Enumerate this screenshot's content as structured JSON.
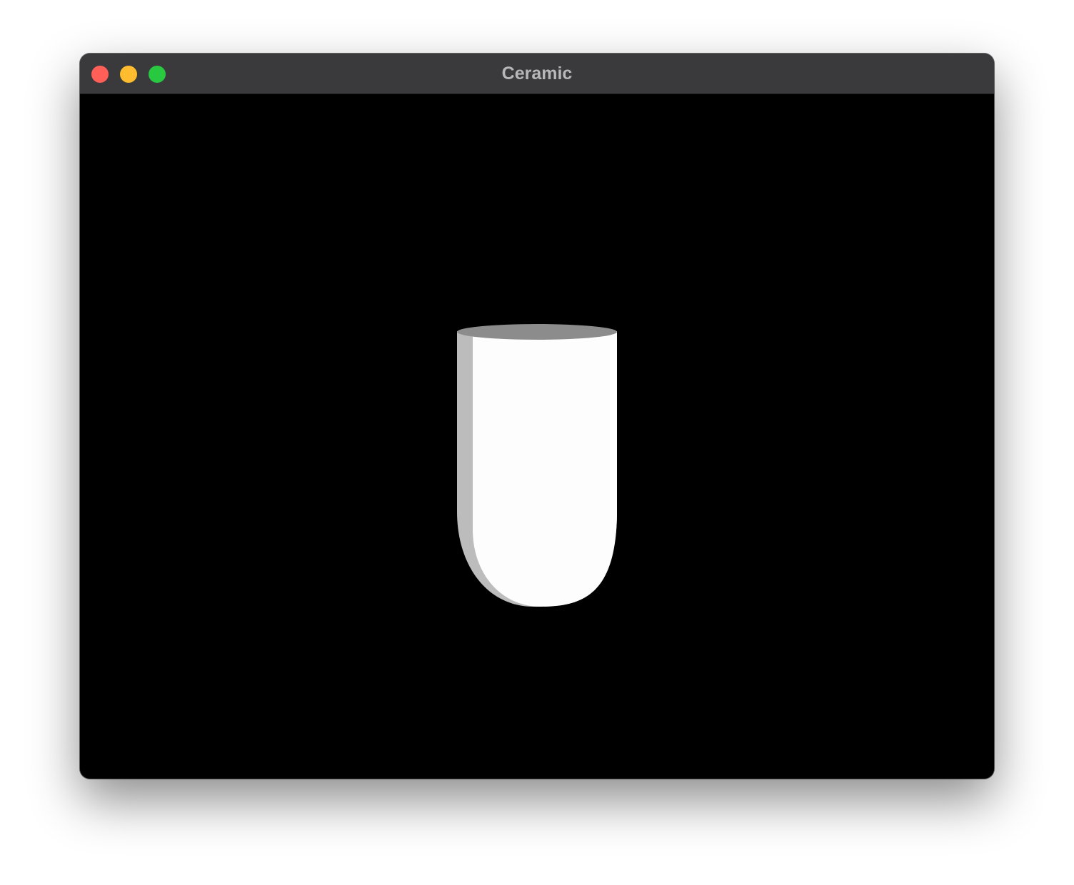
{
  "window": {
    "title": "Ceramic",
    "controls": [
      {
        "name": "close-button",
        "color": "#ff5f57"
      },
      {
        "name": "minimize-button",
        "color": "#febc2e"
      },
      {
        "name": "zoom-button",
        "color": "#28c840"
      }
    ]
  },
  "scene": {
    "background_color": "#000000",
    "object": {
      "icon": "cup-icon",
      "body_color": "#fdfdfd",
      "shadow_color": "#bcbcbc",
      "rim_color": "#8c8c8c"
    }
  }
}
